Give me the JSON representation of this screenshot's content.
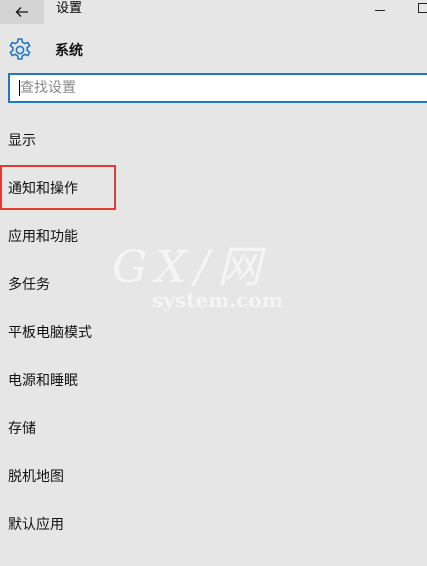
{
  "titlebar": {
    "app_title": "设置",
    "back_icon": "arrow-left-icon",
    "minimize_icon": "minimize-icon",
    "maximize_icon": "maximize-icon"
  },
  "header": {
    "icon": "gear-icon",
    "title": "系统"
  },
  "search": {
    "placeholder": "查找设置",
    "value": ""
  },
  "nav": {
    "items": [
      {
        "label": "显示"
      },
      {
        "label": "通知和操作",
        "highlighted": true
      },
      {
        "label": "应用和功能"
      },
      {
        "label": "多任务"
      },
      {
        "label": "平板电脑模式"
      },
      {
        "label": "电源和睡眠"
      },
      {
        "label": "存储"
      },
      {
        "label": "脱机地图"
      },
      {
        "label": "默认应用"
      }
    ]
  },
  "colors": {
    "background": "#e6e6e6",
    "accent": "#1e78c8",
    "highlight_border": "#e03a3a",
    "gear": "#1e78c8"
  },
  "watermark": {
    "big": "GX/网",
    "small": "system.com"
  }
}
